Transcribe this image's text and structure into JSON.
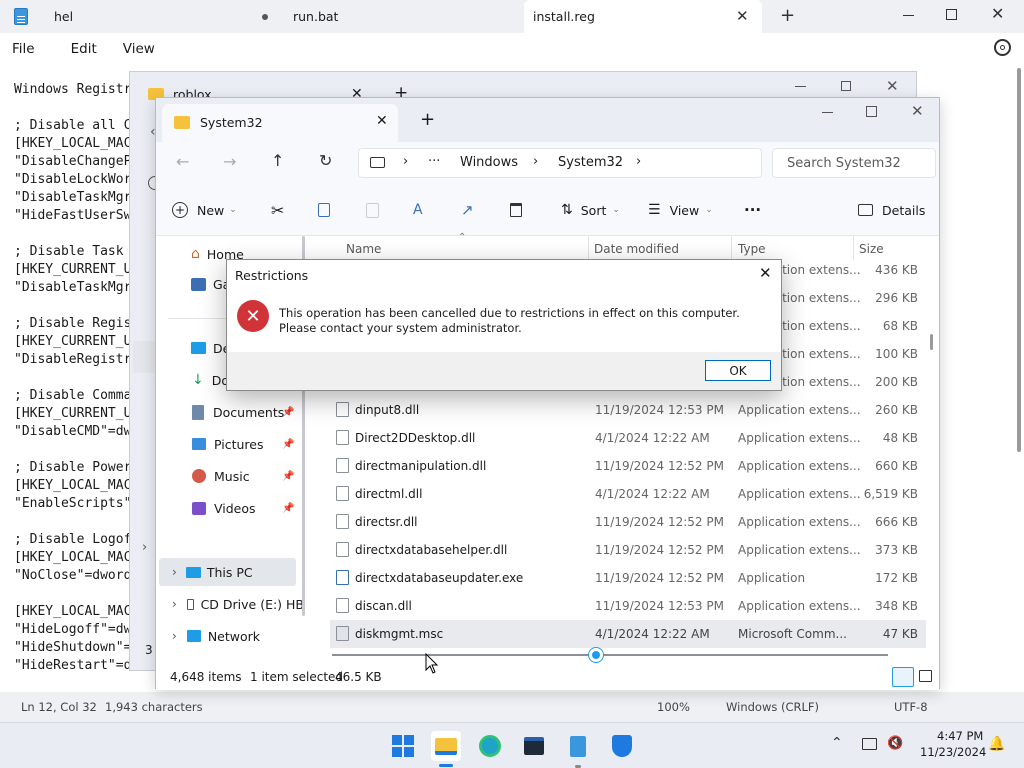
{
  "notepad": {
    "tabs": [
      "hel",
      "run.bat",
      "install.reg"
    ],
    "menu": [
      "File",
      "Edit",
      "View"
    ],
    "lines": [
      "Windows Registr",
      "",
      "; Disable all C",
      "[HKEY_LOCAL_MAC",
      "\"DisableChangeP",
      "\"DisableLockWor",
      "\"DisableTaskMgr",
      "\"HideFastUserSw",
      "",
      "; Disable Task ",
      "[HKEY_CURRENT_U",
      "\"DisableTaskMgr",
      "",
      "; Disable Regis",
      "[HKEY_CURRENT_U",
      "\"DisableRegistr",
      "",
      "; Disable Comma",
      "[HKEY_CURRENT_U",
      "\"DisableCMD\"=dw",
      "",
      "; Disable Power",
      "[HKEY_LOCAL_MAC",
      "\"EnableScripts\"",
      "",
      "; Disable Logof",
      "[HKEY_LOCAL_MAC",
      "\"NoClose\"=dword",
      "",
      "[HKEY_LOCAL_MAC",
      "\"HideLogoff\"=dw",
      "\"HideShutdown\"=",
      "\"HideRestart\"=dwor"
    ],
    "status": {
      "position": "Ln 12, Col 32",
      "chars": "1,943 characters",
      "zoom": "100%",
      "line_ending": "Windows (CRLF)",
      "encoding": "UTF-8"
    }
  },
  "bg_explorer": {
    "tab": "roblox"
  },
  "explorer": {
    "tab": "System32",
    "breadcrumb": [
      "Windows",
      "System32"
    ],
    "ellipsis": "···",
    "search_placeholder": "Search System32",
    "toolbar": {
      "new": "New",
      "sort": "Sort",
      "view": "View",
      "more": "···",
      "details": "Details"
    },
    "nav": {
      "home": "Home",
      "gallery": "Ga",
      "desktop": "De",
      "downloads": "Do",
      "documents": "Documents",
      "pictures": "Pictures",
      "music": "Music",
      "videos": "Videos",
      "this_pc": "This PC",
      "cd_drive": "CD Drive (E:) HB",
      "network": "Network"
    },
    "columns": [
      "Name",
      "Date modified",
      "Type",
      "Size"
    ],
    "rows_hidden": [
      {
        "type": "Application extens...",
        "size": "436 KB"
      },
      {
        "type": "Application extens...",
        "size": "296 KB"
      },
      {
        "type": "Application extens...",
        "size": "68 KB"
      },
      {
        "type": "Application extens...",
        "size": "100 KB"
      },
      {
        "type": "Application extens...",
        "size": "200 KB"
      }
    ],
    "rows": [
      {
        "name": "dinput8.dll",
        "date": "11/19/2024 12:53 PM",
        "type": "Application extens...",
        "size": "260 KB"
      },
      {
        "name": "Direct2DDesktop.dll",
        "date": "4/1/2024 12:22 AM",
        "type": "Application extens...",
        "size": "48 KB"
      },
      {
        "name": "directmanipulation.dll",
        "date": "11/19/2024 12:52 PM",
        "type": "Application extens...",
        "size": "660 KB"
      },
      {
        "name": "directml.dll",
        "date": "4/1/2024 12:22 AM",
        "type": "Application extens...",
        "size": "6,519 KB"
      },
      {
        "name": "directsr.dll",
        "date": "11/19/2024 12:52 PM",
        "type": "Application extens...",
        "size": "666 KB"
      },
      {
        "name": "directxdatabasehelper.dll",
        "date": "11/19/2024 12:52 PM",
        "type": "Application extens...",
        "size": "373 KB"
      },
      {
        "name": "directxdatabaseupdater.exe",
        "date": "11/19/2024 12:52 PM",
        "type": "Application",
        "size": "172 KB"
      },
      {
        "name": "discan.dll",
        "date": "11/19/2024 12:53 PM",
        "type": "Application extens...",
        "size": "348 KB"
      },
      {
        "name": "diskmgmt.msc",
        "date": "4/1/2024 12:22 AM",
        "type": "Microsoft Comm...",
        "size": "47 KB"
      }
    ],
    "status": {
      "items": "4,648 items",
      "selected": "1 item selected",
      "sel_size": "46.5 KB"
    }
  },
  "dialog": {
    "title": "Restrictions",
    "message": "This operation has been cancelled due to restrictions in effect on this computer. Please contact your system administrator.",
    "ok": "OK"
  },
  "taskbar": {
    "time": "4:47 PM",
    "date": "11/23/2024"
  },
  "colors": {
    "accent": "#0067c0",
    "error": "#d13438",
    "folder": "#f4c23d"
  }
}
